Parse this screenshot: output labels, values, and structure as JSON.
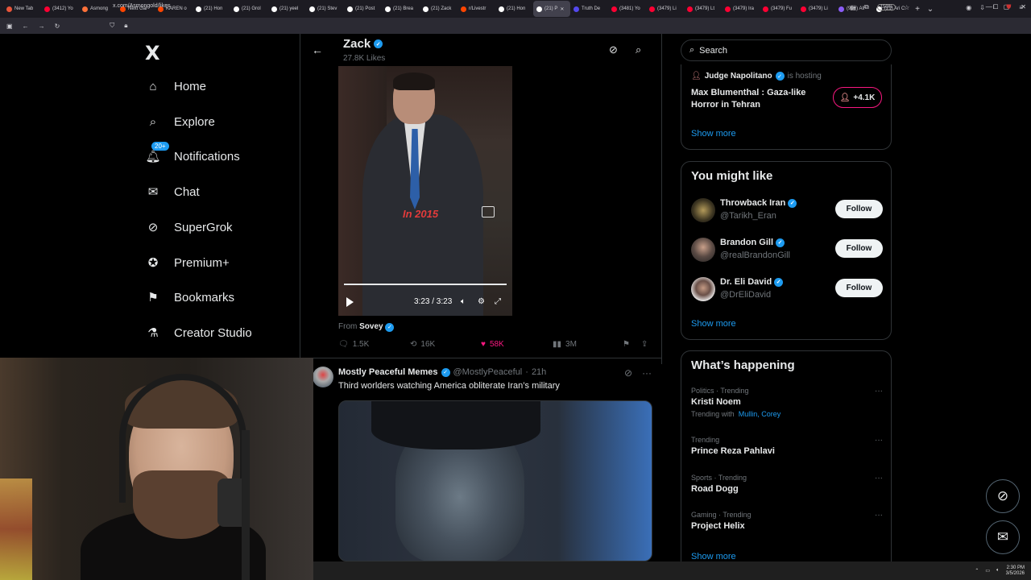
{
  "browser": {
    "tabs": [
      {
        "label": "New Tab",
        "color": "#e8553a"
      },
      {
        "label": "(3412) Yo",
        "color": "#ff0033"
      },
      {
        "label": "Asmong",
        "color": "#ff7139"
      },
      {
        "label": "Next Gar",
        "color": "#ff4500"
      },
      {
        "label": "KAREN o",
        "color": "#ff4500"
      },
      {
        "label": "(21) Hon",
        "color": "#ffffff"
      },
      {
        "label": "(21) Grol",
        "color": "#ffffff"
      },
      {
        "label": "(21) yeel",
        "color": "#ffffff"
      },
      {
        "label": "(21) Stev",
        "color": "#ffffff"
      },
      {
        "label": "(21) Post",
        "color": "#ffffff"
      },
      {
        "label": "(21) Brea",
        "color": "#ffffff"
      },
      {
        "label": "(21) Zack",
        "color": "#ffffff"
      },
      {
        "label": "r/Livestr",
        "color": "#ff4500"
      },
      {
        "label": "(21) Hon",
        "color": "#ffffff"
      },
      {
        "label": "(21) P",
        "color": "#ffffff",
        "active": true
      },
      {
        "label": "Truth De",
        "color": "#5448ee"
      },
      {
        "label": "(3481) Yo",
        "color": "#ff0033"
      },
      {
        "label": "(3479) Li",
        "color": "#ff0033"
      },
      {
        "label": "(3479) Lt",
        "color": "#ff0033"
      },
      {
        "label": "(3479) Ira",
        "color": "#ff0033"
      },
      {
        "label": "(3479) Fu",
        "color": "#ff0033"
      },
      {
        "label": "(3479) Li",
        "color": "#ff0033"
      },
      {
        "label": "(99+) All",
        "color": "#8b5cf6"
      },
      {
        "label": "(21) Ari C",
        "color": "#ffffff"
      }
    ],
    "url": "x.com/Asmongold/likes",
    "zoom": "150%"
  },
  "nav": {
    "logo": "X",
    "items": [
      {
        "label": "Home",
        "icon": "home-icon"
      },
      {
        "label": "Explore",
        "icon": "search-icon"
      },
      {
        "label": "Notifications",
        "icon": "bell-icon",
        "badge": "20+"
      },
      {
        "label": "Chat",
        "icon": "mail-icon"
      },
      {
        "label": "SuperGrok",
        "icon": "grok-icon"
      },
      {
        "label": "Premium+",
        "icon": "premium-icon"
      },
      {
        "label": "Bookmarks",
        "icon": "bookmark-icon"
      },
      {
        "label": "Creator Studio",
        "icon": "flask-icon"
      }
    ]
  },
  "header": {
    "name": "Zack",
    "likes": "27.8K Likes"
  },
  "tweet1": {
    "video_caption": "In 2015",
    "time": "3:23 / 3:23",
    "progress": 1.0,
    "from_label": "From",
    "from_user": "Sovey",
    "replies": "1.5K",
    "reposts": "16K",
    "likes": "58K",
    "views": "3M"
  },
  "tweet2": {
    "name": "Mostly Peaceful Memes",
    "handle": "@MostlyPeaceful",
    "time": "21h",
    "text": "Third worlders watching America obliterate Iran’s military"
  },
  "sidebar": {
    "search_placeholder": "Search",
    "space": {
      "host": "Judge Napolitano",
      "hosting": "is hosting",
      "title": "Max Blumenthal : Gaza-like Horror in Tehran",
      "listeners": "+4.1K",
      "show_more": "Show more"
    },
    "who_to_follow": {
      "title": "You might like",
      "users": [
        {
          "name": "Throwback Iran",
          "handle": "@Tarikh_Eran",
          "button": "Follow"
        },
        {
          "name": "Brandon Gill",
          "handle": "@realBrandonGill",
          "button": "Follow"
        },
        {
          "name": "Dr. Eli David",
          "handle": "@DrEliDavid",
          "button": "Follow"
        }
      ],
      "show_more": "Show more"
    },
    "happening": {
      "title": "What’s happening",
      "trends": [
        {
          "meta": "Politics · Trending",
          "name": "Kristi Noem",
          "with_label": "Trending with",
          "with": "Mullin, Corey"
        },
        {
          "meta": "Trending",
          "name": "Prince Reza Pahlavi"
        },
        {
          "meta": "Sports · Trending",
          "name": "Road Dogg"
        },
        {
          "meta": "Gaming · Trending",
          "name": "Project Helix"
        }
      ],
      "show_more": "Show more"
    }
  },
  "taskbar": {
    "time": "2:30 PM",
    "date": "3/5/2026"
  }
}
